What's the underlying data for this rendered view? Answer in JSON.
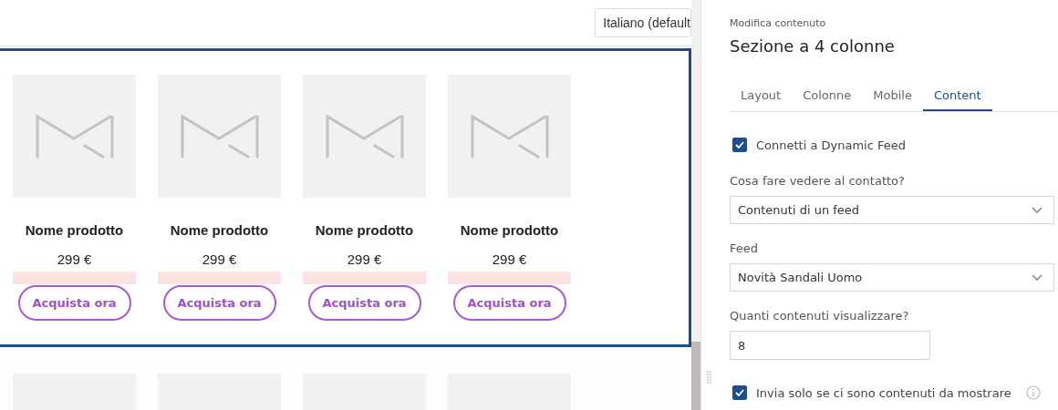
{
  "language_select": {
    "value": "Italiano (default"
  },
  "section": {
    "selected": true,
    "cards": [
      {
        "kind": "placeholder",
        "name": "Nome prodotto",
        "price": "299 €",
        "button": "Acquista ora"
      },
      {
        "kind": "placeholder",
        "name": "Nome prodotto",
        "price": "299 €",
        "button": "Acquista ora"
      },
      {
        "kind": "placeholder",
        "name": "Nome prodotto",
        "price": "299 €",
        "button": "Acquista ora"
      },
      {
        "kind": "placeholder",
        "name": "Nome prodotto",
        "price": "299 €",
        "button": "Acquista ora"
      }
    ]
  },
  "next_row": [
    {
      "kind": "placeholder"
    },
    {
      "kind": "placeholder"
    },
    {
      "kind": "placeholder"
    },
    {
      "kind": "placeholder"
    }
  ],
  "panel": {
    "subtitle": "Modifica contenuto",
    "title": "Sezione a 4 colonne",
    "tabs": [
      {
        "label": "Layout",
        "selected": false
      },
      {
        "label": "Colonne",
        "selected": false
      },
      {
        "label": "Mobile",
        "selected": false
      },
      {
        "label": "Content",
        "selected": true
      }
    ],
    "fields": [
      {
        "kind": "checkbox",
        "label": "Connetti a Dynamic Feed",
        "checked": true
      },
      {
        "kind": "select",
        "label": "Cosa fare vedere al contatto?",
        "value": "Contenuti di un feed"
      },
      {
        "kind": "select",
        "label": "Feed",
        "value": "Novità Sandali Uomo"
      },
      {
        "kind": "number",
        "label": "Quanti contenuti visualizzare?",
        "value": "8"
      },
      {
        "kind": "checkbox",
        "label": "Invia solo se ci sono contenuti da mostrare",
        "checked": true,
        "info": true
      }
    ]
  }
}
